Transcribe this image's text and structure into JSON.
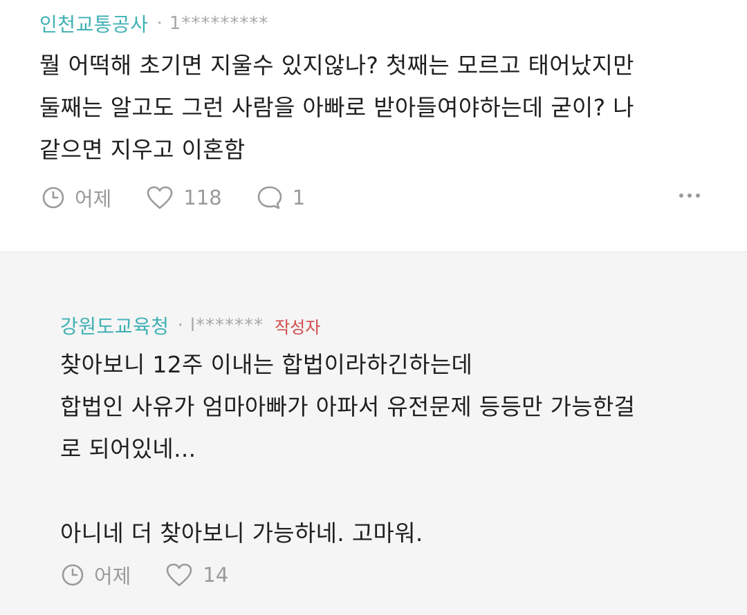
{
  "comments": [
    {
      "author": "인천교통공사",
      "separator": "·",
      "user_id": "1*********",
      "body": "뭘 어떡해 초기면 지울수 있지않나? 첫째는 모르고 태어났지만\n둘째는 알고도 그런 사람을 아빠로 받아들여야하는데 굳이? 나\n같으면 지우고 이혼함",
      "time": "어제",
      "likes": "118",
      "replies": "1"
    },
    {
      "author": "강원도교육청",
      "separator": "·",
      "user_id": "l*******",
      "writer_badge": "작성자",
      "body": "찾아보니 12주 이내는 합법이라하긴하는데\n합법인 사유가 엄마아빠가 아파서 유전문제 등등만 가능한걸\n로 되어있네...\n\n아니네 더 찾아보니 가능하네. 고마워.",
      "time": "어제",
      "likes": "14"
    }
  ],
  "icons": {
    "clock": "clock-icon",
    "heart": "heart-icon",
    "reply": "speech-bubble-icon",
    "more": "more-dots-icon"
  },
  "colors": {
    "author": "#3fb0b5",
    "writer_badge": "#d44a4a",
    "muted": "#9a9a9a",
    "reply_bg": "#f5f5f5"
  }
}
